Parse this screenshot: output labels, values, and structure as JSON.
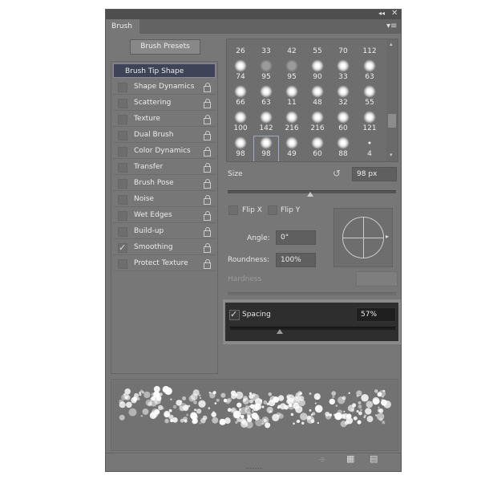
{
  "window": {
    "tab": "Brush",
    "collapse_icon": "double-chevron-left-icon",
    "close_icon": "close-icon",
    "menu_icon": "panel-menu-icon"
  },
  "presets_button": "Brush Presets",
  "settings": [
    {
      "label": "Brush Tip Shape",
      "selected": true
    },
    {
      "label": "Shape Dynamics",
      "checked": false
    },
    {
      "label": "Scattering",
      "checked": false
    },
    {
      "label": "Texture",
      "checked": false
    },
    {
      "label": "Dual Brush",
      "checked": false
    },
    {
      "label": "Color Dynamics",
      "checked": false
    },
    {
      "label": "Transfer",
      "checked": false
    },
    {
      "label": "Brush Pose",
      "checked": false
    },
    {
      "label": "Noise",
      "checked": false
    },
    {
      "label": "Wet Edges",
      "checked": false
    },
    {
      "label": "Build-up",
      "checked": false
    },
    {
      "label": "Smoothing",
      "checked": true
    },
    {
      "label": "Protect Texture",
      "checked": false
    }
  ],
  "brush_sizes_top": [
    "26",
    "33",
    "42",
    "55",
    "70",
    "112"
  ],
  "brush_rows": [
    [
      "74",
      "95",
      "95",
      "90",
      "33",
      "63"
    ],
    [
      "66",
      "63",
      "11",
      "48",
      "32",
      "55"
    ],
    [
      "100",
      "142",
      "216",
      "216",
      "60",
      "121"
    ],
    [
      "98",
      "98",
      "49",
      "60",
      "88",
      "4"
    ]
  ],
  "selected_brush": "98",
  "size": {
    "label": "Size",
    "value": "98 px",
    "slider_fraction": 0.49
  },
  "flip_x": {
    "label": "Flip X",
    "checked": false
  },
  "flip_y": {
    "label": "Flip Y",
    "checked": false
  },
  "angle": {
    "label": "Angle:",
    "value": "0°"
  },
  "roundness": {
    "label": "Roundness:",
    "value": "100%"
  },
  "hardness": {
    "label": "Hardness",
    "value": ""
  },
  "spacing": {
    "label": "Spacing",
    "checked": true,
    "value": "57%",
    "slider_fraction": 0.3
  },
  "footer_icons": [
    "toggle-live-tip-icon",
    "grid-icon",
    "new-preset-icon"
  ]
}
